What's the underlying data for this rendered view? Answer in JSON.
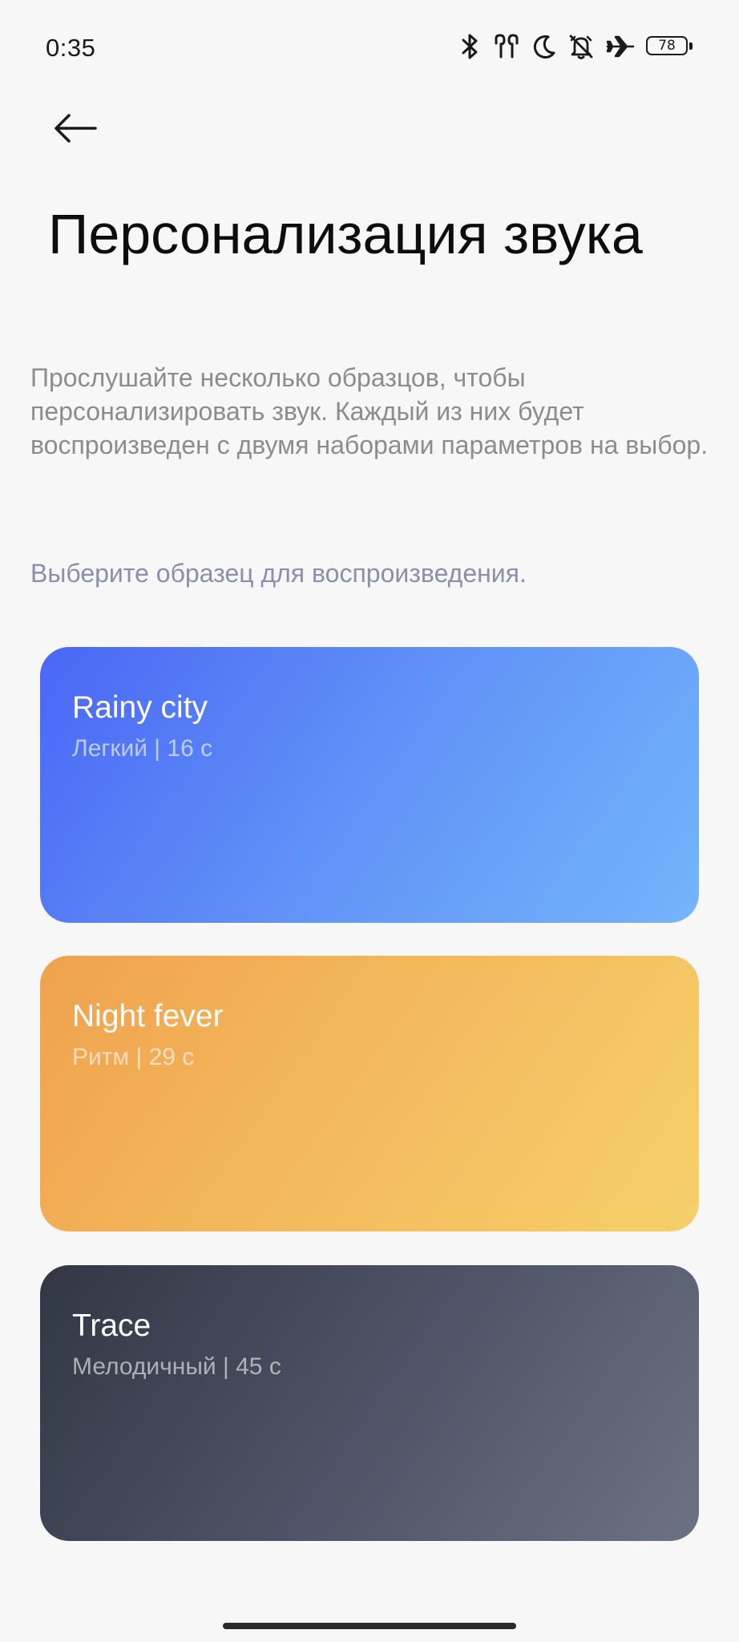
{
  "status_bar": {
    "time": "0:35",
    "icons": [
      "bluetooth-icon",
      "earbuds-icon",
      "moon-icon",
      "bell-off-icon",
      "airplane-icon"
    ],
    "battery": "78"
  },
  "header": {
    "back_icon": "arrow-left-icon",
    "title": "Персонализация звука"
  },
  "main": {
    "description": "Прослушайте несколько образцов, чтобы персонализировать звук. Каждый из них будет воспроизведен с двумя наборами параметров на выбор.",
    "hint": "Выберите образец для воспроизведения.",
    "samples": [
      {
        "title": "Rainy city",
        "subtitle": "Легкий | 16 с",
        "color_start": "#4a67f5",
        "color_end": "#73b5fb"
      },
      {
        "title": "Night fever",
        "subtitle": "Ритм | 29 с",
        "color_start": "#f0a24e",
        "color_end": "#f6d06a"
      },
      {
        "title": "Trace",
        "subtitle": "Мелодичный | 45 с",
        "color_start": "#323744",
        "color_end": "#6b7283"
      }
    ]
  },
  "colors": {
    "background": "#f7f7f7",
    "description_text": "#8c8c8c",
    "hint_text": "#8a8fae"
  }
}
